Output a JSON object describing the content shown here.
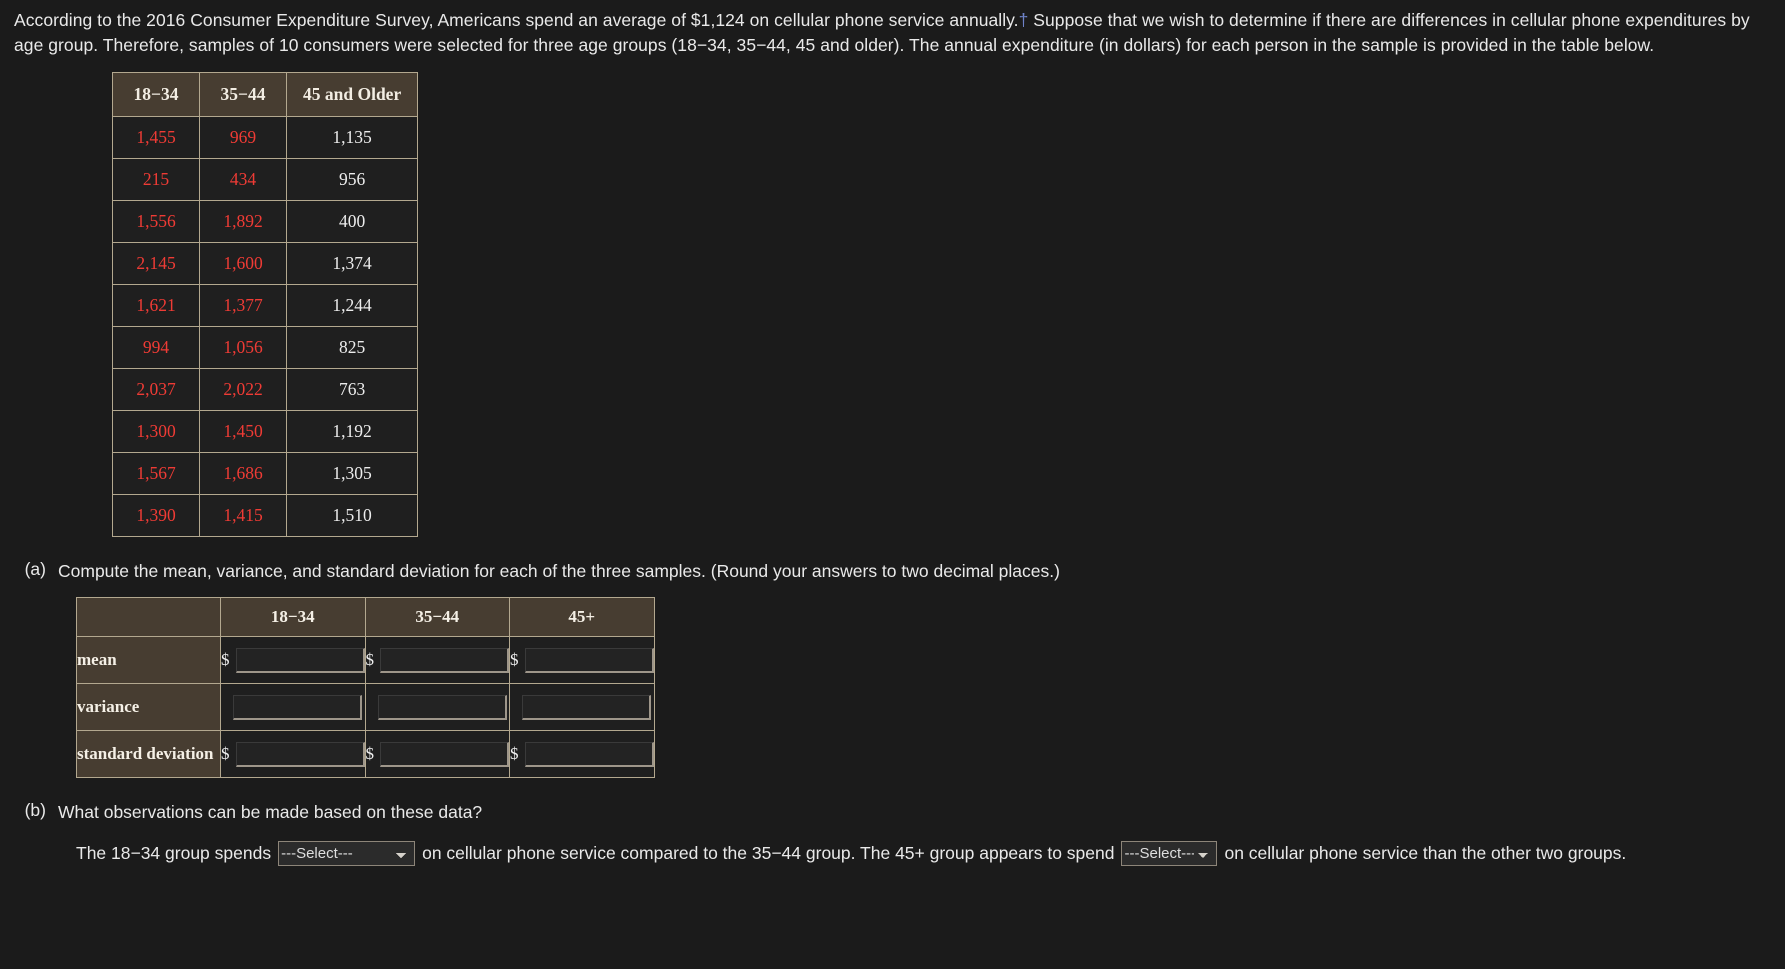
{
  "intro": {
    "part1": "According to the 2016 Consumer Expenditure Survey, Americans spend an average of $1,124 on cellular phone service annually.",
    "dagger": "†",
    "part2": " Suppose that we wish to determine if there are differences in cellular phone expenditures by age group. Therefore, samples of 10 consumers were selected for three age groups (18−34, 35−44, 45 and older). The annual expenditure (in dollars) for each person in the sample is provided in the table below."
  },
  "data_table": {
    "headers": [
      "18−34",
      "35−44",
      "45 and Older"
    ],
    "rows": [
      [
        "1,455",
        "969",
        "1,135"
      ],
      [
        "215",
        "434",
        "956"
      ],
      [
        "1,556",
        "1,892",
        "400"
      ],
      [
        "2,145",
        "1,600",
        "1,374"
      ],
      [
        "1,621",
        "1,377",
        "1,244"
      ],
      [
        "994",
        "1,056",
        "825"
      ],
      [
        "2,037",
        "2,022",
        "763"
      ],
      [
        "1,300",
        "1,450",
        "1,192"
      ],
      [
        "1,567",
        "1,686",
        "1,305"
      ],
      [
        "1,390",
        "1,415",
        "1,510"
      ]
    ],
    "highlight_color": "#ef3b35",
    "plain_color": "#ececec",
    "header_bg": "#473d31",
    "border_color": "#b3a88f"
  },
  "part_a": {
    "letter": "(a)",
    "text": "Compute the mean, variance, and standard deviation for each of the three samples. (Round your answers to two decimal places.)",
    "table": {
      "corner_label": "",
      "headers": [
        "18−34",
        "35−44",
        "45+"
      ],
      "rows": [
        {
          "label": "mean",
          "prefix": "$",
          "values": [
            "",
            "",
            ""
          ]
        },
        {
          "label": "variance",
          "prefix": "",
          "values": [
            "",
            "",
            ""
          ]
        },
        {
          "label": "standard deviation",
          "prefix": "$",
          "values": [
            "",
            "",
            ""
          ]
        }
      ]
    }
  },
  "part_b": {
    "letter": "(b)",
    "text": "What observations can be made based on these data?",
    "sentence": {
      "seg1": "The 18−34 group spends",
      "select1_value": "---Select---",
      "seg2": "on cellular phone service compared to the 35−44 group. The 45+ group appears to spend",
      "select2_value": "---Select---",
      "seg3": "on cellular phone service than the other two groups."
    }
  }
}
